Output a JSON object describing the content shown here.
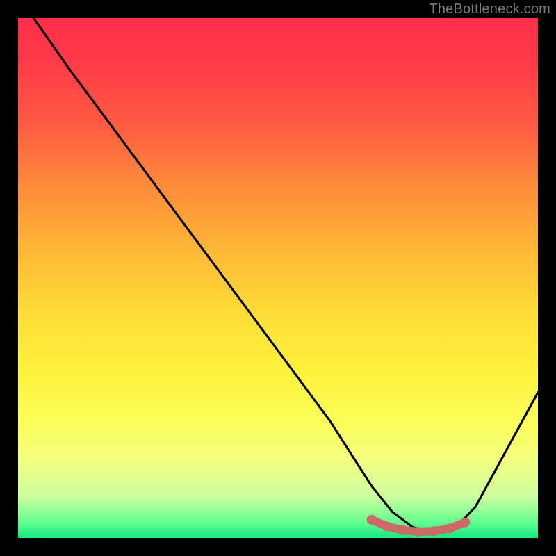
{
  "watermark": "TheBottleneck.com",
  "chart_data": {
    "type": "line",
    "title": "",
    "xlabel": "",
    "ylabel": "",
    "xlim": [
      0,
      100
    ],
    "ylim": [
      0,
      100
    ],
    "series": [
      {
        "name": "bottleneck-curve",
        "x": [
          3,
          10,
          20,
          30,
          40,
          50,
          60,
          68,
          72,
          76,
          80,
          84,
          88,
          100
        ],
        "y": [
          100,
          90,
          76.5,
          63,
          49.5,
          36,
          22.5,
          10,
          5,
          2,
          1.2,
          1.8,
          6,
          28
        ]
      },
      {
        "name": "optimal-band",
        "x": [
          68,
          71,
          74,
          77,
          80,
          83,
          86
        ],
        "y": [
          3.5,
          2.2,
          1.5,
          1.2,
          1.3,
          1.8,
          3.0
        ]
      }
    ],
    "annotations": [],
    "colors": {
      "curve": "#000000",
      "optimal_band": "#cc6a68",
      "gradient_top": "#ff2f4a",
      "gradient_bottom": "#14e880",
      "frame": "#000000"
    }
  }
}
